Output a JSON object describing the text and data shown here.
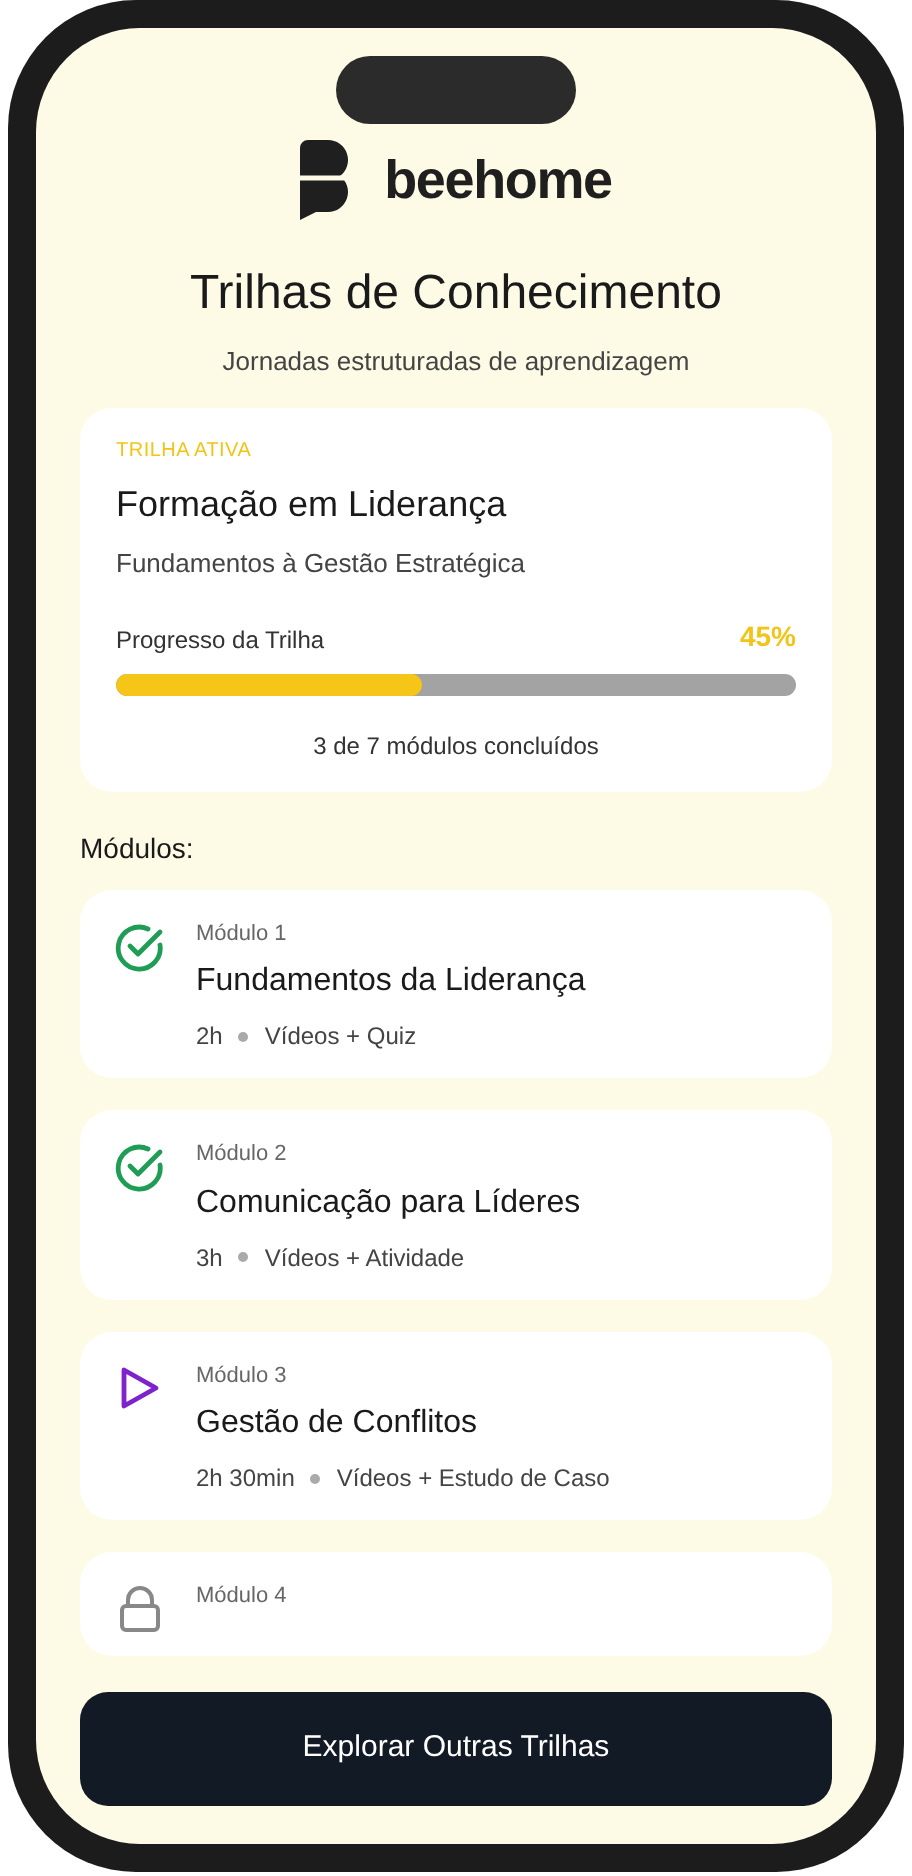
{
  "brand": {
    "name": "beehome"
  },
  "header": {
    "title": "Trilhas de Conhecimento",
    "subtitle": "Jornadas estruturadas de aprendizagem"
  },
  "active_track": {
    "badge": "TRILHA ATIVA",
    "title": "Formação em Liderança",
    "subtitle": "Fundamentos à Gestão Estratégica",
    "progress_label": "Progresso da Trilha",
    "progress_value": "45%",
    "level": 0.45,
    "summary": "3 de 7 módulos concluídos"
  },
  "modules_heading": "Módulos:",
  "modules": [
    {
      "kind": "completed",
      "number": "Módulo 1",
      "title": "Fundamentos da Liderança",
      "duration": "2h",
      "format": "Vídeos + Quiz"
    },
    {
      "kind": "completed",
      "number": "Módulo 2",
      "title": "Comunicação para Líderes",
      "duration": "3h",
      "format": "Vídeos + Atividade"
    },
    {
      "kind": "current",
      "number": "Módulo 3",
      "title": "Gestão de Conflitos",
      "duration": "2h 30min",
      "format": "Vídeos + Estudo de Caso"
    },
    {
      "kind": "locked",
      "number": "Módulo 4"
    }
  ],
  "button": {
    "label": "Explorar Outras Trilhas"
  }
}
